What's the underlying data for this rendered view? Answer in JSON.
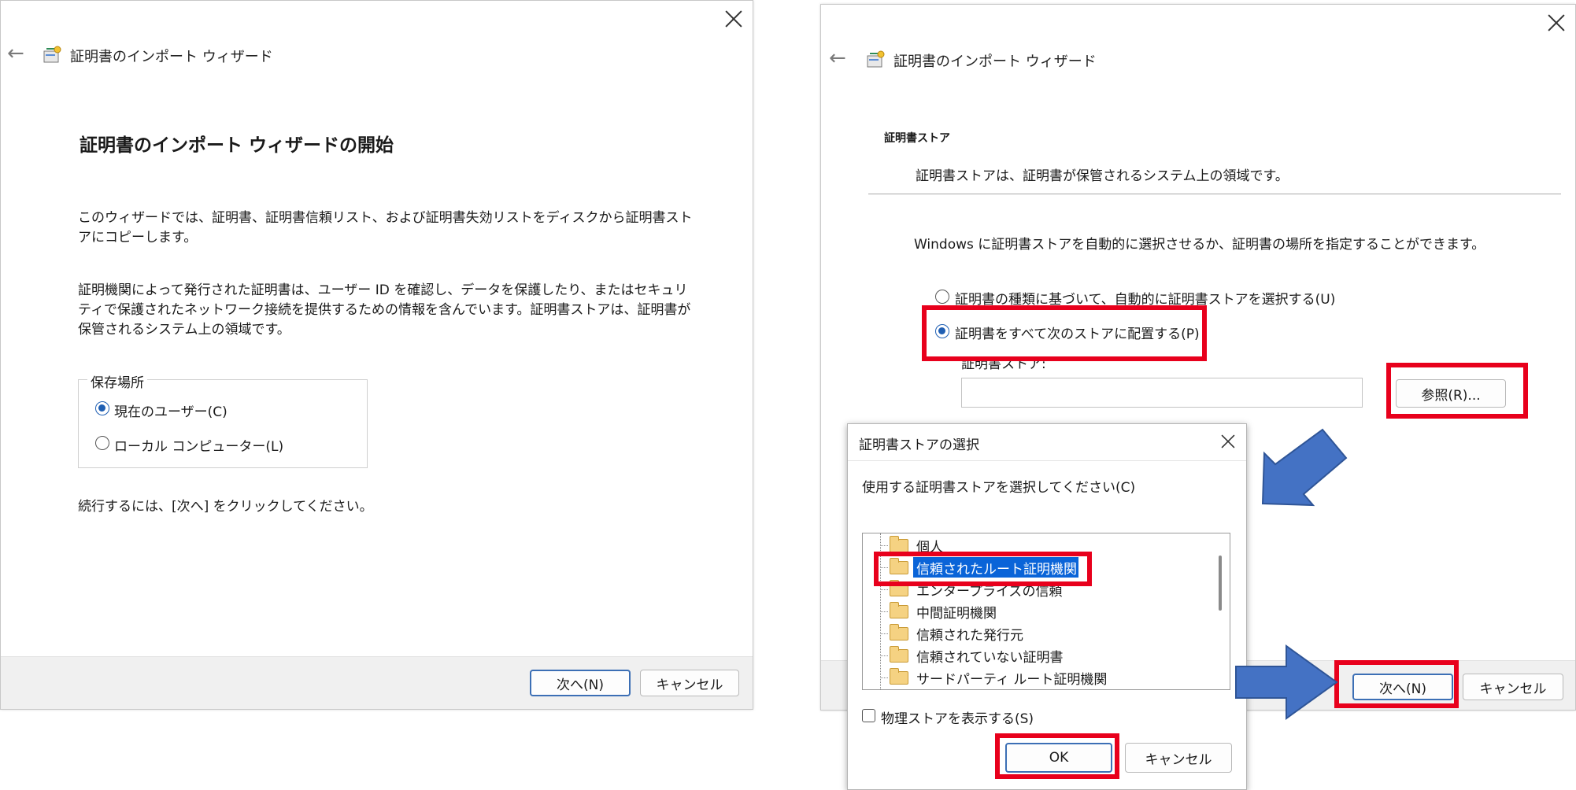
{
  "left_wizard": {
    "title": "証明書のインポート ウィザード",
    "heading": "証明書のインポート ウィザードの開始",
    "paragraph1": "このウィザードでは、証明書、証明書信頼リスト、および証明書失効リストをディスクから証明書ストアにコピーします。",
    "paragraph2": "証明機関によって発行された証明書は、ユーザー ID を確認し、データを保護したり、またはセキュリティで保護されたネットワーク接続を提供するための情報を含んでいます。証明書ストアは、証明書が保管されるシステム上の領域です。",
    "storage_group_label": "保存場所",
    "option_current_user": "現在のユーザー(C)",
    "option_local_machine": "ローカル コンピューター(L)",
    "continue_text": "続行するには、[次へ] をクリックしてください。",
    "next_button": "次へ(N)",
    "cancel_button": "キャンセル"
  },
  "right_wizard": {
    "title": "証明書のインポート ウィザード",
    "section_heading": "証明書ストア",
    "section_desc": "証明書ストアは、証明書が保管されるシステム上の領域です。",
    "instruction": "Windows に証明書ストアを自動的に選択させるか、証明書の場所を指定することができます。",
    "option_auto": "証明書の種類に基づいて、自動的に証明書ストアを選択する(U)",
    "option_place_all": "証明書をすべて次のストアに配置する(P)",
    "store_label": "証明書ストア:",
    "store_value": "",
    "browse_button": "参照(R)...",
    "next_button": "次へ(N)",
    "cancel_button": "キャンセル"
  },
  "select_store_dialog": {
    "title": "証明書ストアの選択",
    "prompt": "使用する証明書ストアを選択してください(C)",
    "stores": [
      "個人",
      "信頼されたルート証明機関",
      "エンタープライズの信頼",
      "中間証明機関",
      "信頼された発行元",
      "信頼されていない証明書",
      "サードパーティ ルート証明機関"
    ],
    "selected_store": "信頼されたルート証明機関",
    "show_physical_label": "物理ストアを表示する(S)",
    "ok_button": "OK",
    "cancel_button": "キャンセル"
  },
  "colors": {
    "highlight": "#e8001c",
    "arrow": "#4472c4",
    "selection": "#0a64d8",
    "primary_button_border": "#3c6fb5"
  },
  "icons": [
    "back-arrow-icon",
    "certificate-wizard-icon",
    "close-icon",
    "folder-icon",
    "blue-arrow-icon"
  ]
}
